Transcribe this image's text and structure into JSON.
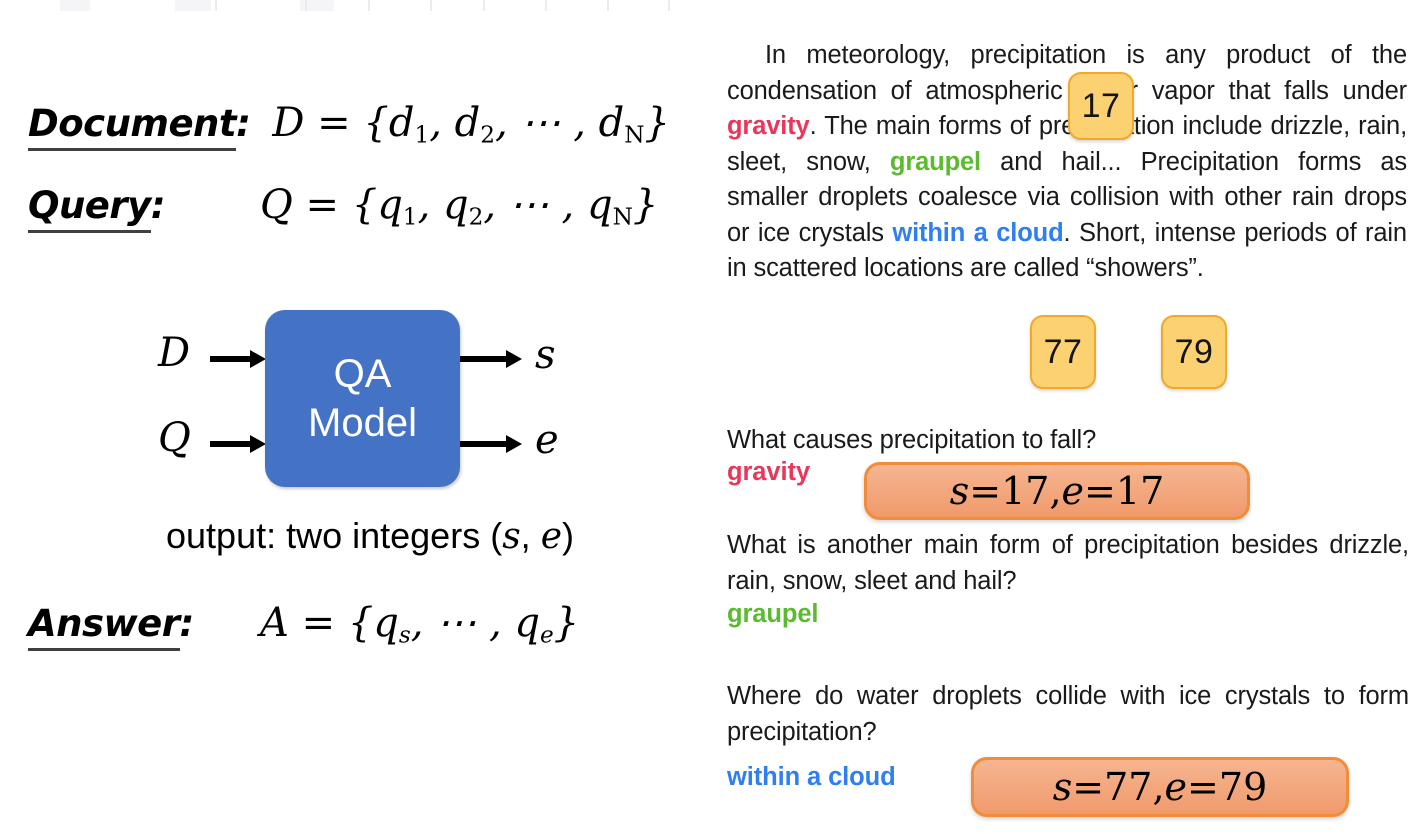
{
  "theme": {
    "node_blue": "#4472C4",
    "badge_fill": "#FCD172",
    "badge_border": "#F0A92B",
    "pill_fill_top": "#F6B590",
    "pill_fill_bottom": "#F09A6C",
    "pill_border": "#F08C3A",
    "keyword_red": "#E8375A",
    "keyword_green": "#5BBB2E",
    "keyword_blue": "#2E7FF0"
  },
  "left": {
    "document": {
      "label": "Document",
      "colon": ":",
      "formula_prefix": "D = {d",
      "sub1": "1",
      "mid1": ", d",
      "sub2": "2",
      "mid2": ", ⋯ , d",
      "subN": "N",
      "close": "}"
    },
    "query": {
      "label": "Query",
      "colon": ":",
      "formula_prefix": "Q = {q",
      "sub1": "1",
      "mid1": ", q",
      "sub2": "2",
      "mid2": ", ⋯ , q",
      "subN": "N",
      "close": "}"
    },
    "answer": {
      "label": "Answer",
      "colon": ":",
      "formula_prefix": "A = {q",
      "sub1": "s",
      "mid1": ", ⋯ , q",
      "sub2": "e",
      "close": "}"
    },
    "diagram": {
      "node_line1": "QA",
      "node_line2": "Model",
      "input_top": "D",
      "input_bottom": "Q",
      "output_top": "s",
      "output_bottom": "e"
    },
    "output_caption": {
      "prefix": "output: two integers (",
      "var_s": "s",
      "comma": ", ",
      "var_e": "e",
      "suffix": ")"
    }
  },
  "right": {
    "passage": {
      "line1_a": "In meteorology, precipitation is any product of the condensation of atmospheric water vapor that falls under ",
      "kw_gravity": "gravity",
      "line1_b": ". The main forms of precipitation include drizzle, rain, sleet, snow, ",
      "kw_graupel": "graupel",
      "line1_c": " and hail... Precipitation forms as smaller droplets coalesce via collision with other rain drops or ice crystals ",
      "kw_cloud": "within a cloud",
      "line1_d": ". Short, intense periods of rain in scattered locations are called “showers”."
    },
    "badges": [
      {
        "value": "17"
      },
      {
        "value": "77"
      },
      {
        "value": "79"
      }
    ],
    "qa": [
      {
        "question": "What causes precipitation to fall?",
        "answer": "gravity",
        "answer_color": "red",
        "span": {
          "s_var": "s",
          "eq1": " = ",
          "s_val": "17",
          "sep": ", ",
          "e_var": "e",
          "eq2": " = ",
          "e_val": "17"
        }
      },
      {
        "question": "What is another main form of precipitation besides drizzle, rain, snow, sleet and hail?",
        "answer": "graupel",
        "answer_color": "green",
        "span": null
      },
      {
        "question": "Where do water droplets collide with ice crystals to form precipitation?",
        "answer": "within a cloud",
        "answer_color": "blue",
        "span": {
          "s_var": "s",
          "eq1": " = ",
          "s_val": "77",
          "sep": ", ",
          "e_var": "e",
          "eq2": " = ",
          "e_val": "79"
        }
      }
    ]
  }
}
